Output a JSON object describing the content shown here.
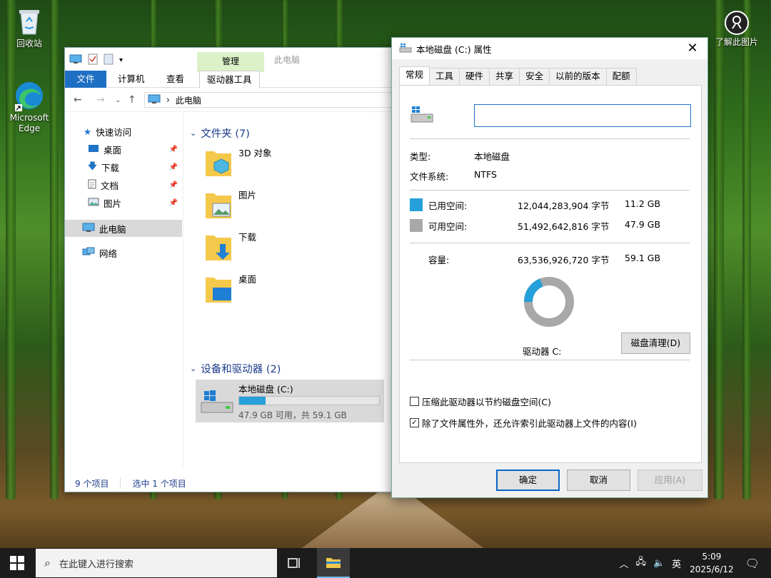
{
  "desktop": {
    "recycle_bin": "回收站",
    "edge_line1": "Microsoft",
    "edge_line2": "Edge",
    "learn_picture": "了解此图片"
  },
  "explorer": {
    "contextual_group": "管理",
    "window_name": "此电脑",
    "tabs": [
      "文件",
      "计算机",
      "查看",
      "驱动器工具"
    ],
    "address": "此电脑",
    "nav": {
      "quick_access": "快速访问",
      "desktop": "桌面",
      "downloads": "下载",
      "documents": "文档",
      "pictures": "图片",
      "this_pc": "此电脑",
      "network": "网络"
    },
    "folders_header": "文件夹 (7)",
    "folders": [
      "3D 对象",
      "图片",
      "下载",
      "桌面"
    ],
    "devices_header": "设备和驱动器 (2)",
    "drive": {
      "name": "本地磁盘 (C:)",
      "used_fraction": 0.19,
      "size_text": "47.9 GB 可用，共 59.1 GB"
    },
    "status": {
      "items": "9 个项目",
      "selected": "选中 1 个项目"
    }
  },
  "dialog": {
    "title": "本地磁盘 (C:) 属性",
    "tabs": [
      "常规",
      "工具",
      "硬件",
      "共享",
      "安全",
      "以前的版本",
      "配额"
    ],
    "type_label": "类型:",
    "type_value": "本地磁盘",
    "fs_label": "文件系统:",
    "fs_value": "NTFS",
    "used_label": "已用空间:",
    "used_bytes": "12,044,283,904 字节",
    "used_gb": "11.2 GB",
    "free_label": "可用空间:",
    "free_bytes": "51,492,642,816 字节",
    "free_gb": "47.9 GB",
    "capacity_label": "容量:",
    "capacity_bytes": "63,536,926,720 字节",
    "capacity_gb": "59.1 GB",
    "used_fraction": 0.19,
    "used_color": "#26a0da",
    "free_color": "#a8a8a8",
    "drive_label": "驱动器 C:",
    "cleanup_button": "磁盘清理(D)",
    "compress_label": "压缩此驱动器以节约磁盘空间(C)",
    "index_label": "除了文件属性外，还允许索引此驱动器上文件的内容(I)",
    "ok": "确定",
    "cancel": "取消",
    "apply": "应用(A)"
  },
  "taskbar": {
    "search_placeholder": "在此键入进行搜索",
    "ime": "英",
    "time": "5:09",
    "date": "2025/6/12"
  }
}
